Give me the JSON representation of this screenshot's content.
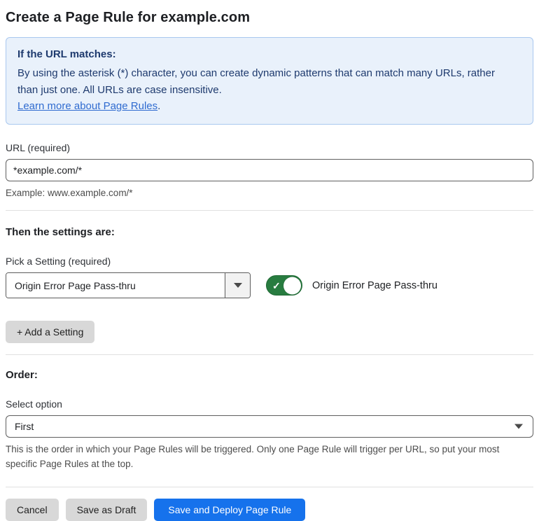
{
  "page": {
    "title": "Create a Page Rule for example.com"
  },
  "info_box": {
    "heading": "If the URL matches:",
    "body": "By using the asterisk (*) character, you can create dynamic patterns that can match many URLs, rather than just one. All URLs are case insensitive.",
    "link_label": "Learn more about Page Rules",
    "link_suffix": "."
  },
  "url_field": {
    "label": "URL (required)",
    "value": "*example.com/*",
    "help": "Example: www.example.com/*"
  },
  "settings_section": {
    "heading": "Then the settings are:",
    "picker_label": "Pick a Setting (required)",
    "picker_value": "Origin Error Page Pass-thru",
    "toggle_state": "on",
    "toggle_check_glyph": "✓",
    "toggle_label": "Origin Error Page Pass-thru",
    "add_button_label": "+ Add a Setting"
  },
  "order_section": {
    "heading": "Order:",
    "select_label": "Select option",
    "select_value": "First",
    "help": "This is the order in which your Page Rules will be triggered. Only one Page Rule will trigger per URL, so put your most specific Page Rules at the top."
  },
  "footer": {
    "cancel_label": "Cancel",
    "save_draft_label": "Save as Draft",
    "save_deploy_label": "Save and Deploy Page Rule"
  },
  "colors": {
    "accent_blue": "#1672ec",
    "toggle_green": "#287c40",
    "info_box_bg": "#e9f1fb",
    "info_box_border": "#a9c8ef",
    "info_text": "#1e3a6e",
    "link_blue": "#2f6bd0",
    "button_gray": "#d8d8d8"
  }
}
